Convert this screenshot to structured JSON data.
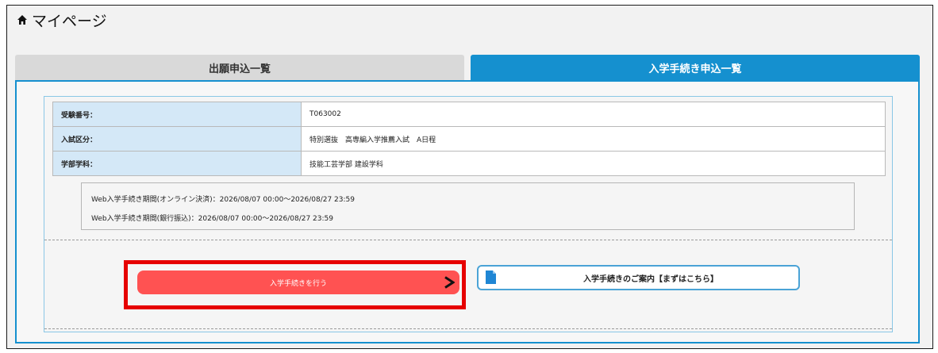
{
  "header": {
    "title": "マイページ",
    "icon": "home-icon"
  },
  "tabs": [
    {
      "label": "出願申込一覧",
      "active": false
    },
    {
      "label": "入学手続き申込一覧",
      "active": true
    }
  ],
  "info": {
    "rows": [
      {
        "label": "受験番号：",
        "value": "T063002"
      },
      {
        "label": "入試区分：",
        "value": "特別選抜　高専編入学推薦入試　A日程"
      },
      {
        "label": "学部学科：",
        "value": "技能工芸学部 建設学科"
      }
    ]
  },
  "periods": {
    "online": "Web入学手続き期間(オンライン決済)：2026/08/07 00:00〜2026/08/27 23:59",
    "bank": "Web入学手続き期間(銀行振込)：2026/08/07 00:00〜2026/08/27 23:59"
  },
  "actions": {
    "enroll_label": "入学手続きを行う",
    "guide_label": "入学手続きのご案内【まずはこちら】"
  },
  "colors": {
    "tab_active": "#1590cf",
    "tab_inactive": "#d9d9d9",
    "enroll_button": "#ff5252",
    "highlight_box": "#e60000",
    "table_header": "#d4e8f7"
  }
}
